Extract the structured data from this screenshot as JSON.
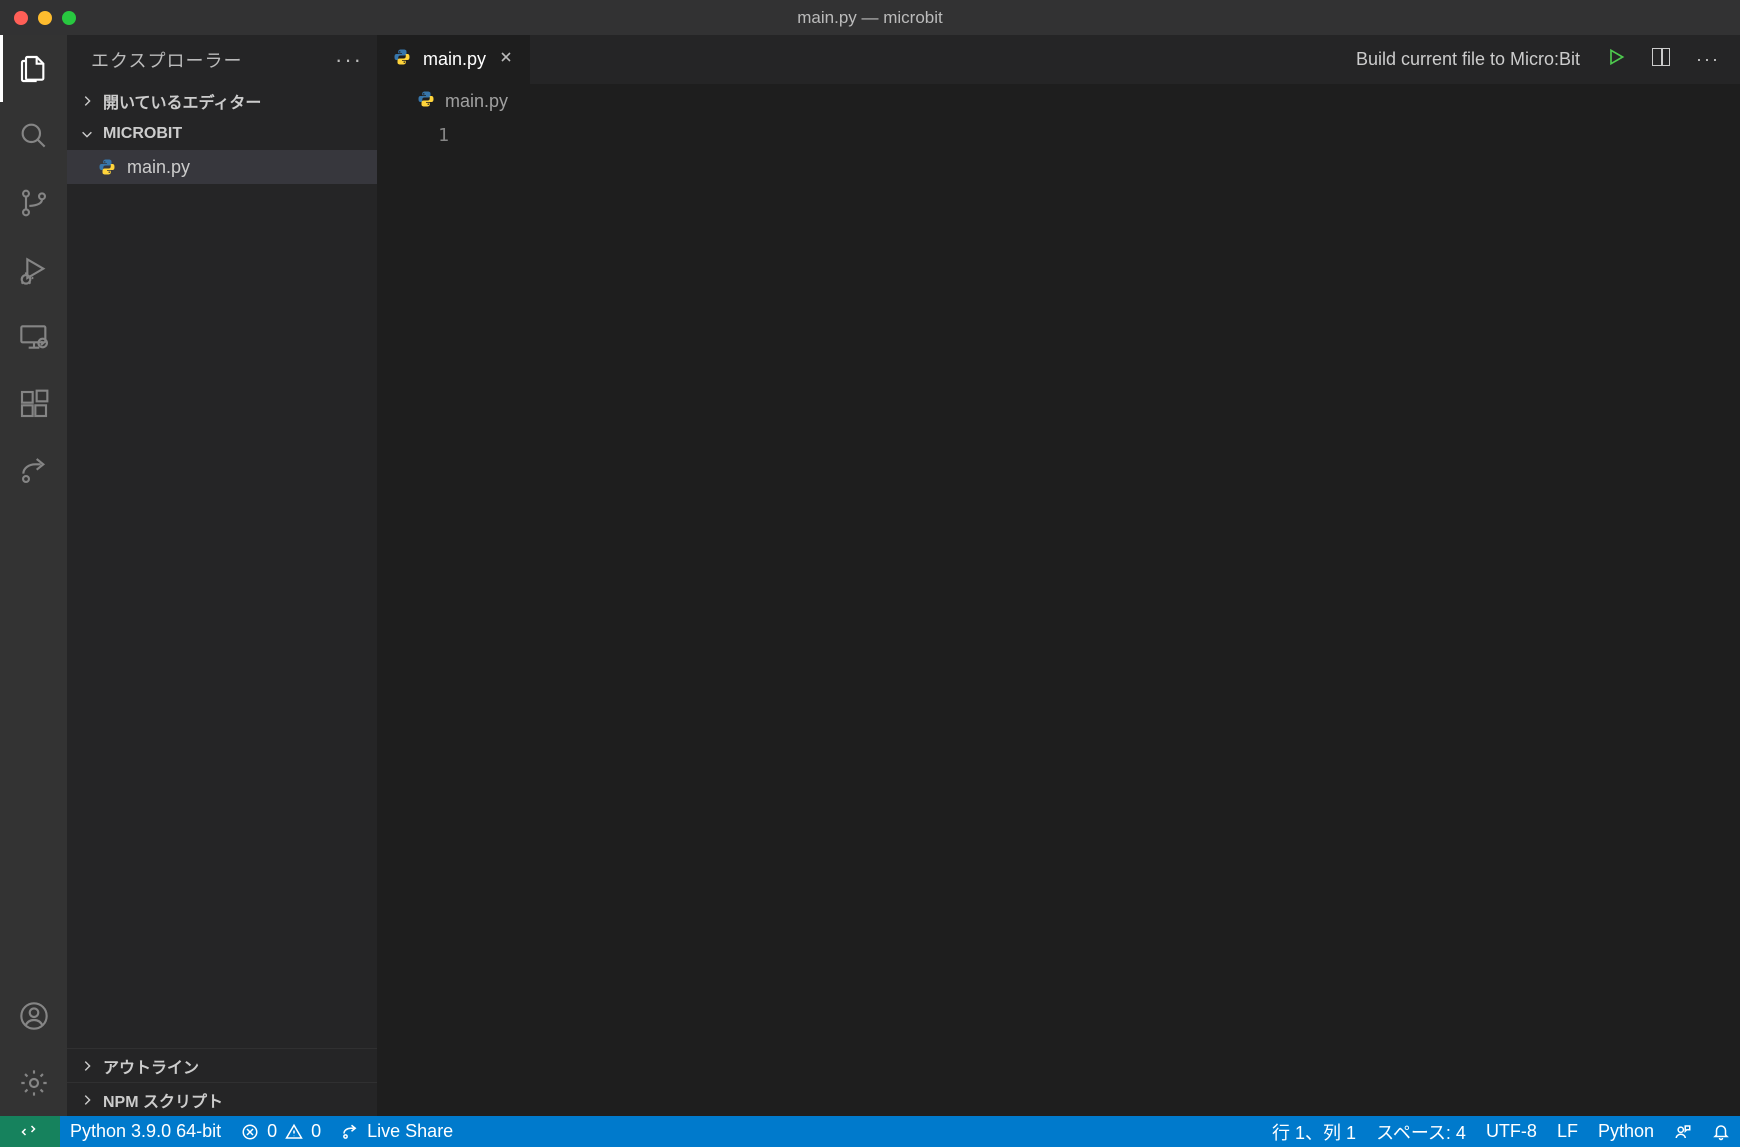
{
  "titlebar": {
    "title": "main.py — microbit"
  },
  "sidebar": {
    "title": "エクスプローラー",
    "sections": {
      "open_editors_label": "開いているエディター",
      "project_label": "MICROBIT",
      "outline_label": "アウトライン",
      "npm_label": "NPM スクリプト"
    },
    "files": [
      {
        "name": "main.py"
      }
    ]
  },
  "tabs": [
    {
      "label": "main.py"
    }
  ],
  "tab_actions": {
    "build_label": "Build current file to Micro:Bit"
  },
  "breadcrumbs": {
    "file": "main.py"
  },
  "editor": {
    "line_numbers": [
      "1"
    ],
    "code": ""
  },
  "status": {
    "python": "Python 3.9.0 64-bit",
    "errors": "0",
    "warnings": "0",
    "live_share": "Live Share",
    "cursor": "行 1、列 1",
    "spaces": "スペース: 4",
    "encoding": "UTF-8",
    "eol": "LF",
    "language": "Python"
  }
}
